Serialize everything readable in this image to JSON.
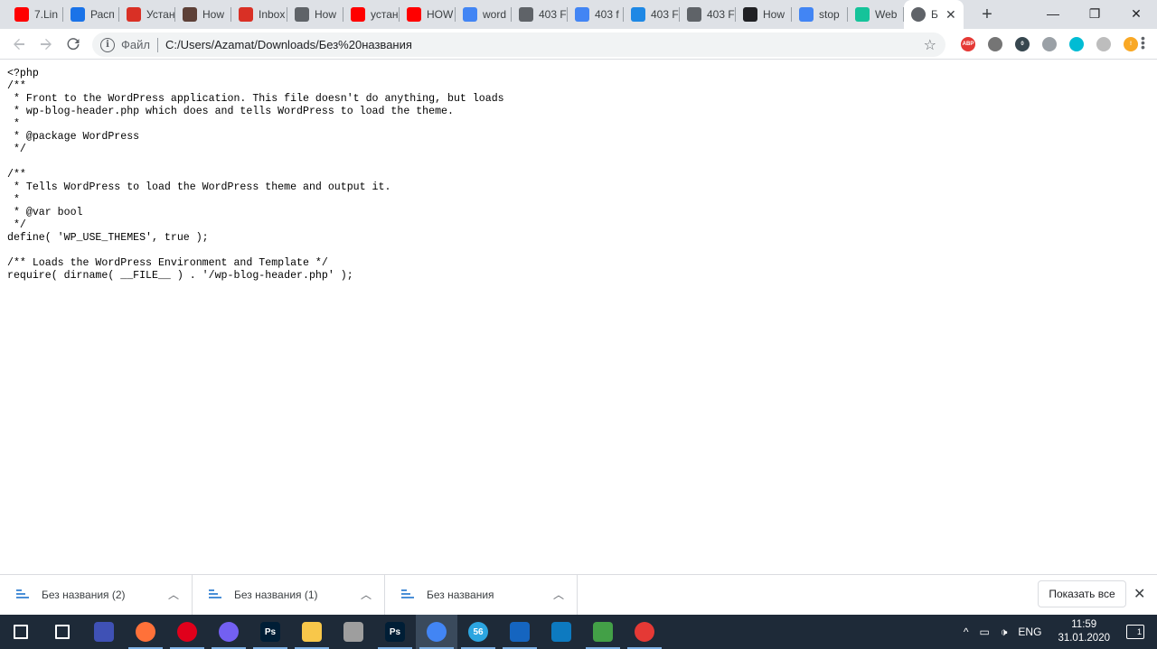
{
  "browser": {
    "tabs": [
      {
        "title": "7.Lin",
        "icon": "youtube-icon",
        "color": "#ff0000"
      },
      {
        "title": "Расп",
        "icon": "vps-icon",
        "color": "#1a73e8"
      },
      {
        "title": "Устан",
        "icon": "presentation-icon",
        "color": "#d93025"
      },
      {
        "title": "How",
        "icon": "site-icon",
        "color": "#5d4037"
      },
      {
        "title": "Inbox",
        "icon": "gmail-icon",
        "color": "#d93025"
      },
      {
        "title": "How",
        "icon": "globe-icon",
        "color": "#5f6368"
      },
      {
        "title": "устан",
        "icon": "youtube-icon",
        "color": "#ff0000"
      },
      {
        "title": "HOW",
        "icon": "youtube-icon",
        "color": "#ff0000"
      },
      {
        "title": "word",
        "icon": "docs-icon",
        "color": "#4285f4"
      },
      {
        "title": "403 F",
        "icon": "globe-icon",
        "color": "#5f6368"
      },
      {
        "title": "403 f",
        "icon": "google-icon",
        "color": "#4285f4"
      },
      {
        "title": "403 F",
        "icon": "refresh-icon",
        "color": "#1e88e5"
      },
      {
        "title": "403 F",
        "icon": "globe-icon",
        "color": "#5f6368"
      },
      {
        "title": "How",
        "icon": "hex-icon",
        "color": "#202124"
      },
      {
        "title": "stop",
        "icon": "google-icon",
        "color": "#4285f4"
      },
      {
        "title": "Web",
        "icon": "grammarly-icon",
        "color": "#15c39a"
      }
    ],
    "active_tab": {
      "title": "Б",
      "icon": "globe-icon",
      "close": "✕"
    },
    "new_tab": "+",
    "window_controls": {
      "minimize": "—",
      "maximize": "❐",
      "close": "✕"
    },
    "address": {
      "scheme_label": "Файл",
      "url": "C:/Users/Azamat/Downloads/Без%20названия"
    },
    "extensions": [
      {
        "icon": "adblock-icon",
        "label": "ABP",
        "color": "#e53935"
      },
      {
        "icon": "cube-icon",
        "label": "",
        "color": "#757575"
      },
      {
        "icon": "extension-badge-icon",
        "label": "0",
        "color": "#37474f"
      },
      {
        "icon": "download-arrow-icon",
        "label": "",
        "color": "#9aa0a6"
      },
      {
        "icon": "react-icon",
        "label": "",
        "color": "#00bcd4"
      },
      {
        "icon": "face-icon",
        "label": "",
        "color": "#bdbdbd"
      },
      {
        "icon": "alert-icon",
        "label": "!",
        "color": "#f9a825"
      }
    ]
  },
  "file_content": {
    "text": "<?php\n/**\n * Front to the WordPress application. This file doesn't do anything, but loads\n * wp-blog-header.php which does and tells WordPress to load the theme.\n *\n * @package WordPress\n */\n\n/**\n * Tells WordPress to load the WordPress theme and output it.\n *\n * @var bool\n */\ndefine( 'WP_USE_THEMES', true );\n\n/** Loads the WordPress Environment and Template */\nrequire( dirname( __FILE__ ) . '/wp-blog-header.php' );"
  },
  "downloads": {
    "items": [
      {
        "name": "Без названия (2)"
      },
      {
        "name": "Без названия (1)"
      },
      {
        "name": "Без названия"
      }
    ],
    "show_all": "Показать все",
    "close": "✕"
  },
  "taskbar": {
    "apps": [
      {
        "icon": "windows-start-icon",
        "color": "#ffffff"
      },
      {
        "icon": "task-view-icon",
        "color": "#ffffff"
      },
      {
        "icon": "save-disk-icon",
        "color": "#3f51b5"
      },
      {
        "icon": "firefox-icon",
        "color": "#ff7139"
      },
      {
        "icon": "opera-icon",
        "color": "#e0001b"
      },
      {
        "icon": "viber-icon",
        "color": "#7360f2"
      },
      {
        "icon": "photoshop-icon",
        "color": "#001e36",
        "label": "Ps"
      },
      {
        "icon": "folder-icon",
        "color": "#f8c74a"
      },
      {
        "icon": "paint-icon",
        "color": "#9e9e9e"
      },
      {
        "icon": "photoshop-icon",
        "color": "#001e36",
        "label": "Ps"
      },
      {
        "icon": "chrome-icon",
        "color": "#4285f4"
      },
      {
        "icon": "telegram-icon",
        "color": "#2ca5e0",
        "label": "56"
      },
      {
        "icon": "network-icon",
        "color": "#1565c0"
      },
      {
        "icon": "virtualbox-icon",
        "color": "#0d7ac0"
      },
      {
        "icon": "notepad-icon",
        "color": "#43a047"
      },
      {
        "icon": "record-icon",
        "color": "#e53935"
      }
    ],
    "tray": {
      "chevron": "^",
      "language": "ENG",
      "time": "11:59",
      "date": "31.01.2020",
      "notifications": "1"
    }
  }
}
